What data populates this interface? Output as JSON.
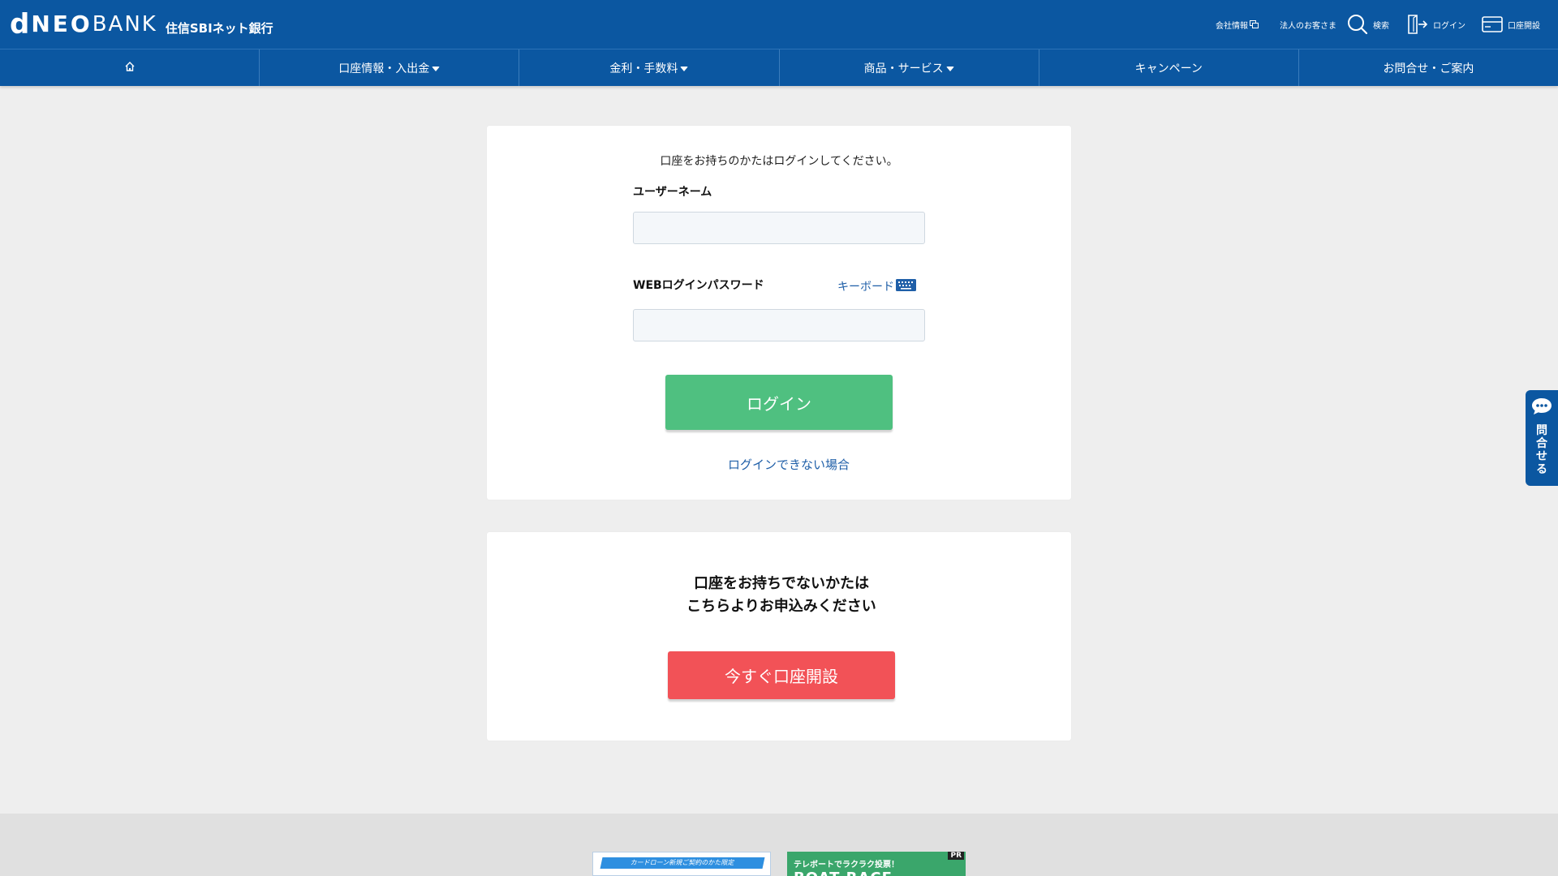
{
  "header": {
    "logo": {
      "d": "d",
      "neo": "NEO",
      "bank": "BANK",
      "sub": "住信SBIネット銀行"
    },
    "utility": {
      "company": "会社情報",
      "corporate": "法人のお客さま",
      "search": "検索",
      "login": "ログイン",
      "open_account": "口座開設"
    },
    "nav": {
      "accounts": "口座情報・入出金",
      "rates": "金利・手数料",
      "products": "商品・サービス",
      "campaign": "キャンペーン",
      "contact": "お問合せ・ご案内"
    }
  },
  "login_card": {
    "intro": "口座をお持ちのかたはログインしてください。",
    "username_label": "ユーザーネーム",
    "username_value": "",
    "password_label": "WEBログインパスワード",
    "password_value": "",
    "keyboard_link": "キーボード",
    "login_button": "ログイン",
    "help_link": "ログインできない場合"
  },
  "open_card": {
    "line1": "口座をお持ちでないかたは",
    "line2": "こちらよりお申込みください",
    "button": "今すぐ口座開設"
  },
  "side_tab": {
    "label": "問合せる"
  },
  "banners": {
    "card_loan": "カードローン新規ご契約のかた限定",
    "boat_top": "テレボートでラクラク投票！",
    "boat_big": "BOAT RACE",
    "pr": "PR"
  },
  "colors": {
    "brand": "#0b57a1",
    "login_button": "#4fc080",
    "open_button": "#f25257",
    "link": "#1f5fa8"
  }
}
